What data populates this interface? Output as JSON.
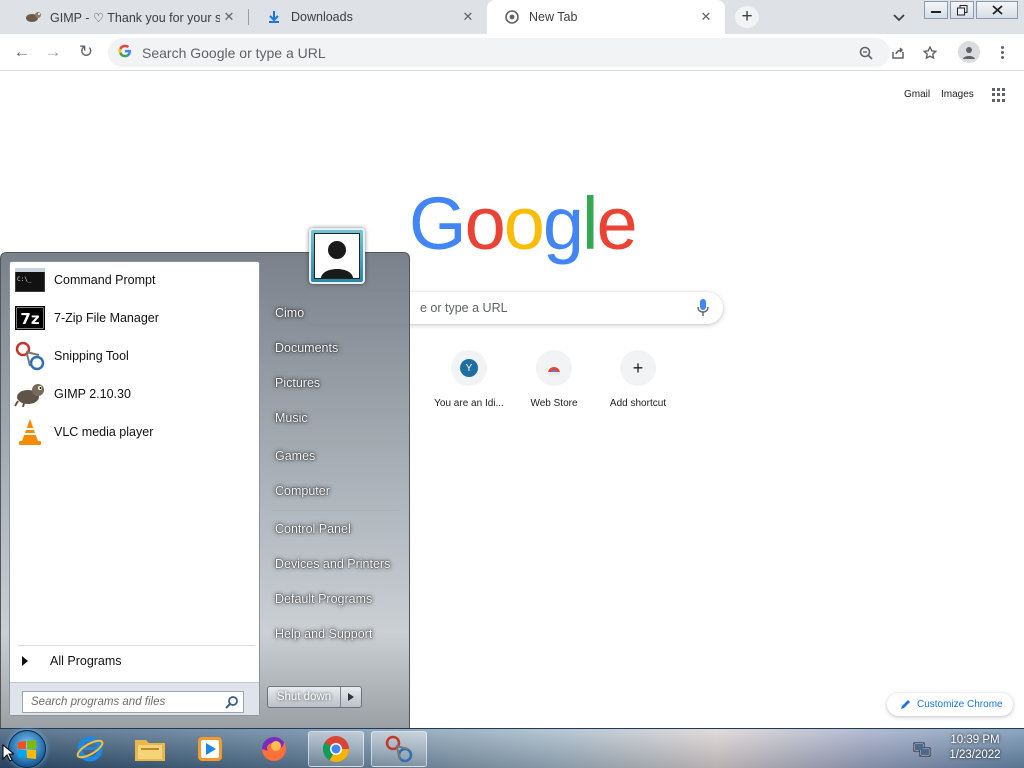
{
  "browser": {
    "tabs": [
      {
        "title": "GIMP - ♡ Thank you for your su",
        "close": "✕"
      },
      {
        "title": "Downloads",
        "close": "✕"
      },
      {
        "title": "New Tab",
        "close": "✕"
      }
    ],
    "new_tab": "+",
    "tab_search": "⌄",
    "window_controls": {
      "minimize": "▭",
      "restore": "❐",
      "close": "✕"
    },
    "toolbar": {
      "back": "←",
      "forward": "→",
      "reload": "↻",
      "menu": "⋮"
    },
    "omnibox_placeholder": "Search Google or type a URL"
  },
  "ntp": {
    "links": {
      "gmail": "Gmail",
      "images": "Images"
    },
    "logo": [
      "G",
      "o",
      "o",
      "g",
      "l",
      "e"
    ],
    "logo_colors": [
      "#4285f4",
      "#ea4335",
      "#fbbc05",
      "#4285f4",
      "#34a853",
      "#ea4335"
    ],
    "search_placeholder": "e or type a URL",
    "shortcuts": [
      {
        "label": "You are an Idi...",
        "letter": "Y"
      },
      {
        "label": "Web Store"
      },
      {
        "label": "Add shortcut",
        "glyph": "+"
      }
    ],
    "customize": "Customize Chrome"
  },
  "start_menu": {
    "programs": [
      {
        "name": "Command Prompt",
        "icon": "cmd-icon"
      },
      {
        "name": "7-Zip File Manager",
        "icon": "7zip-icon",
        "badge": "7z"
      },
      {
        "name": "Snipping Tool",
        "icon": "scissors-icon"
      },
      {
        "name": "GIMP 2.10.30",
        "icon": "gimp-icon"
      },
      {
        "name": "VLC media player",
        "icon": "vlc-icon"
      }
    ],
    "cmd_prompt_glyph": "C:\\_",
    "all_programs": "All Programs",
    "search_placeholder": "Search programs and files",
    "right_items": [
      "Cimo",
      "Documents",
      "Pictures",
      "Music",
      "Games",
      "Computer",
      "Control Panel",
      "Devices and Printers",
      "Default Programs",
      "Help and Support"
    ],
    "shutdown": "Shut down"
  },
  "taskbar": {
    "time": "10:39 PM",
    "date": "1/23/2022",
    "pinned": [
      "internet-explorer-icon",
      "file-explorer-icon",
      "media-player-icon",
      "firefox-icon",
      "chrome-icon",
      "snipping-tool-icon"
    ]
  },
  "colors": {
    "google_blue": "#1a73e8",
    "tab_strip": "#dee1e6"
  }
}
